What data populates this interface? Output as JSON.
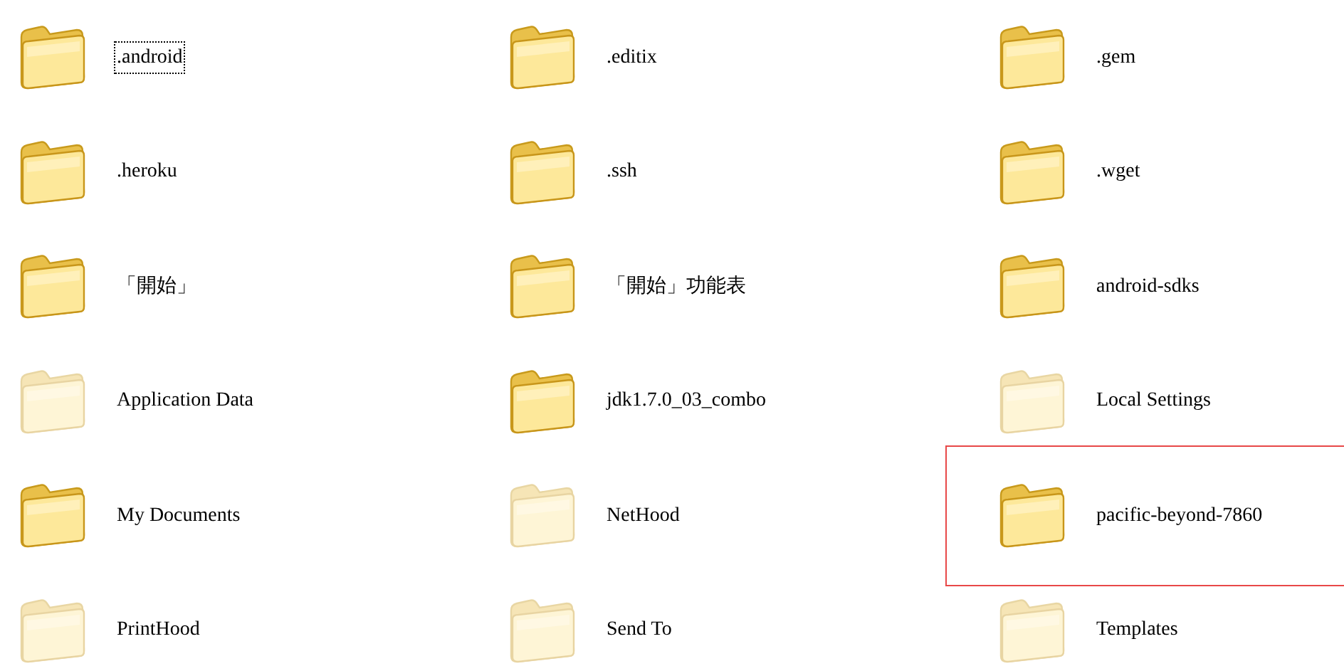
{
  "folders": [
    {
      "name": ".android",
      "hidden": false,
      "focused": true,
      "highlighted": false
    },
    {
      "name": ".editix",
      "hidden": false,
      "focused": false,
      "highlighted": false
    },
    {
      "name": ".gem",
      "hidden": false,
      "focused": false,
      "highlighted": false
    },
    {
      "name": ".heroku",
      "hidden": false,
      "focused": false,
      "highlighted": false
    },
    {
      "name": ".ssh",
      "hidden": false,
      "focused": false,
      "highlighted": false
    },
    {
      "name": ".wget",
      "hidden": false,
      "focused": false,
      "highlighted": false
    },
    {
      "name": "「開始」",
      "hidden": false,
      "focused": false,
      "highlighted": false
    },
    {
      "name": "「開始」功能表",
      "hidden": false,
      "focused": false,
      "highlighted": false
    },
    {
      "name": "android-sdks",
      "hidden": false,
      "focused": false,
      "highlighted": false
    },
    {
      "name": "Application Data",
      "hidden": true,
      "focused": false,
      "highlighted": false
    },
    {
      "name": "jdk1.7.0_03_combo",
      "hidden": false,
      "focused": false,
      "highlighted": false
    },
    {
      "name": "Local Settings",
      "hidden": true,
      "focused": false,
      "highlighted": false
    },
    {
      "name": "My Documents",
      "hidden": false,
      "focused": false,
      "highlighted": false
    },
    {
      "name": "NetHood",
      "hidden": true,
      "focused": false,
      "highlighted": false
    },
    {
      "name": "pacific-beyond-7860",
      "hidden": false,
      "focused": false,
      "highlighted": true
    },
    {
      "name": "PrintHood",
      "hidden": true,
      "focused": false,
      "highlighted": false
    },
    {
      "name": "Send To",
      "hidden": true,
      "focused": false,
      "highlighted": false
    },
    {
      "name": "Templates",
      "hidden": true,
      "focused": false,
      "highlighted": false
    }
  ]
}
